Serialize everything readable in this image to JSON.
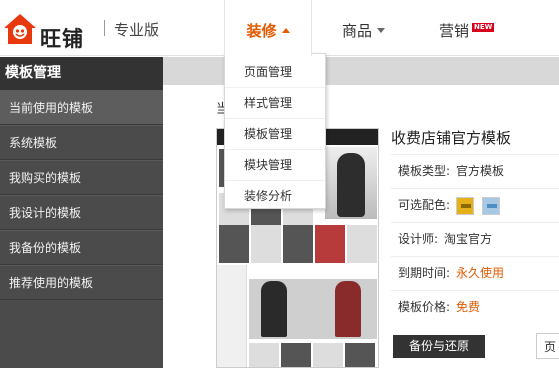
{
  "header": {
    "logo_text": "旺铺",
    "edition": "专业版",
    "nav": {
      "decorate": "装修",
      "goods": "商品",
      "marketing": "营销",
      "new_badge": "NEW"
    }
  },
  "dropdown": {
    "items": [
      "页面管理",
      "样式管理",
      "模板管理",
      "模块管理",
      "装修分析"
    ]
  },
  "sidebar": {
    "title": "模板管理",
    "items": [
      "当前使用的模板",
      "系统模板",
      "我购买的模板",
      "我设计的模板",
      "我备份的模板",
      "推荐使用的模板"
    ]
  },
  "main": {
    "crumb_fragment": "当",
    "template": {
      "title": "收费店铺官方模板",
      "type_label": "模板类型:",
      "type_value": "官方模板",
      "colors_label": "可选配色:",
      "designer_label": "设计师:",
      "designer_value": "淘宝官方",
      "expire_label": "到期时间:",
      "expire_value": "永久使用",
      "price_label": "模板价格:",
      "price_value": "免费"
    },
    "backup_button": "备份与还原",
    "page_button": "页"
  },
  "colors": {
    "accent": "#e35a00",
    "sidebar_bg": "#4b4b4b",
    "swatch_yellow": "#e6b118",
    "swatch_blue": "#a6c8e4"
  }
}
